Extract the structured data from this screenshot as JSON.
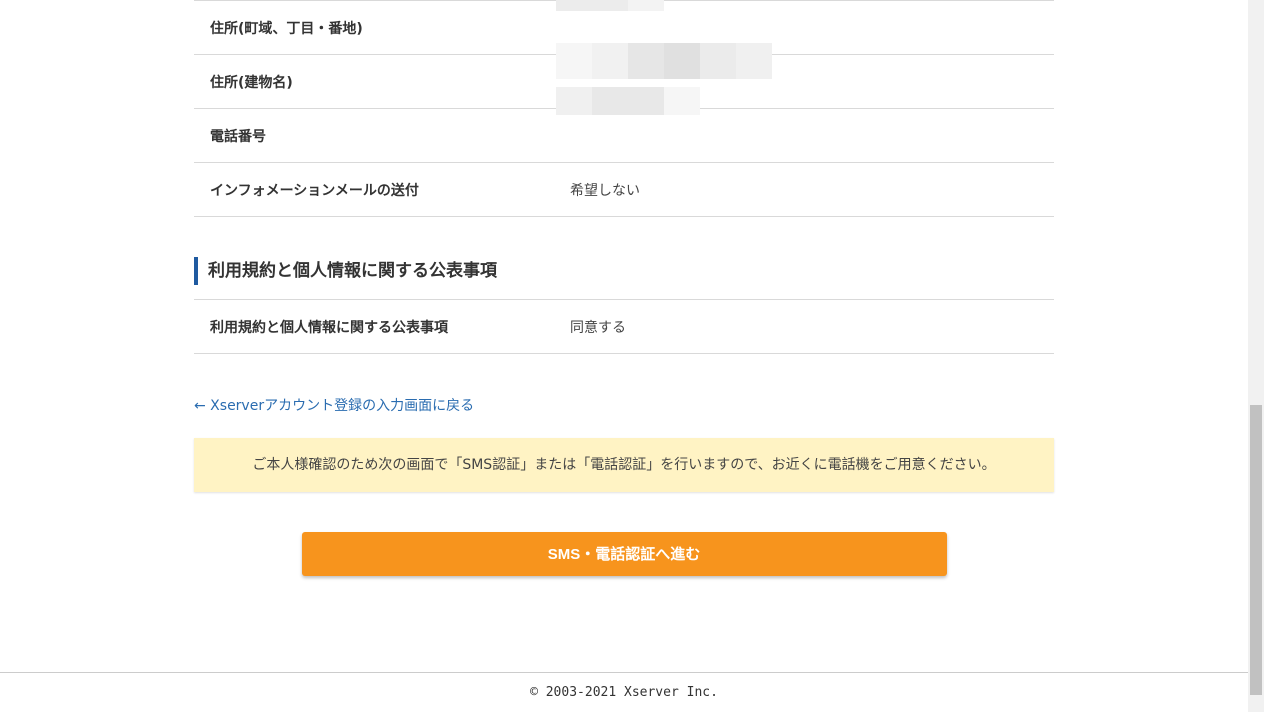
{
  "info_rows": [
    {
      "label": "住所(町域、丁目・番地)",
      "value": ""
    },
    {
      "label": "住所(建物名)",
      "value": ""
    },
    {
      "label": "電話番号",
      "value": ""
    },
    {
      "label": "インフォメーションメールの送付",
      "value": "希望しない"
    }
  ],
  "terms_section": {
    "heading": "利用規約と個人情報に関する公表事項",
    "row_label": "利用規約と個人情報に関する公表事項",
    "row_value": "同意する"
  },
  "back_link": "← Xserverアカウント登録の入力画面に戻る",
  "notice": "ご本人様確認のため次の画面で「SMS認証」または「電話認証」を行いますので、お近くに電話機をご用意ください。",
  "cta_label": "SMS・電話認証へ進む",
  "footer": "© 2003-2021 Xserver Inc.",
  "colors": {
    "accent_button": "#f7941d",
    "notice_bg": "#fff3c4",
    "heading_bar": "#1f5aa0",
    "link": "#2a6cb0"
  }
}
